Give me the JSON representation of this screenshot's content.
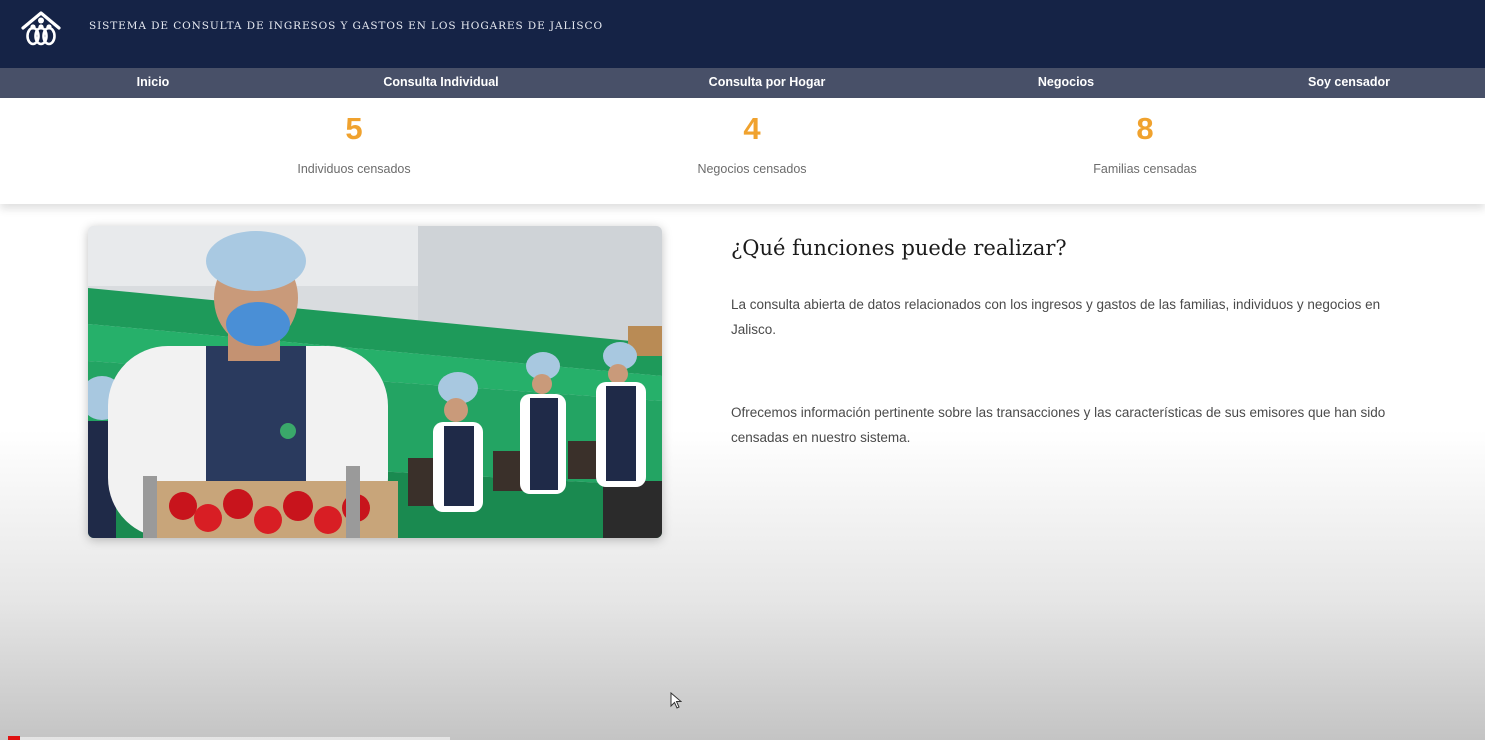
{
  "header": {
    "title": "Sistema de Consulta de Ingresos y Gastos en los Hogares de Jalisco",
    "logo_icon": "family-house-logo-icon"
  },
  "nav": {
    "items": [
      {
        "label": "Inicio"
      },
      {
        "label": "Consulta Individual"
      },
      {
        "label": "Consulta por Hogar"
      },
      {
        "label": "Negocios"
      },
      {
        "label": "Soy censador"
      }
    ]
  },
  "stats": [
    {
      "value": "5",
      "label": "Individuos censados"
    },
    {
      "value": "4",
      "label": "Negocios censados"
    },
    {
      "value": "8",
      "label": "Familias censadas"
    }
  ],
  "content": {
    "title": "¿Qué funciones puede realizar?",
    "paragraphs": [
      "La consulta abierta de datos relacionados con los ingresos y gastos de las familias, individuos y negocios en Jalisco.",
      "Ofrecemos información pertinente sobre las transacciones y las características de sus emisores que han sido censadas en nuestro sistema."
    ]
  },
  "colors": {
    "header_bg": "#152346",
    "nav_bg": "#485068",
    "stat_accent": "#f0a22e"
  }
}
